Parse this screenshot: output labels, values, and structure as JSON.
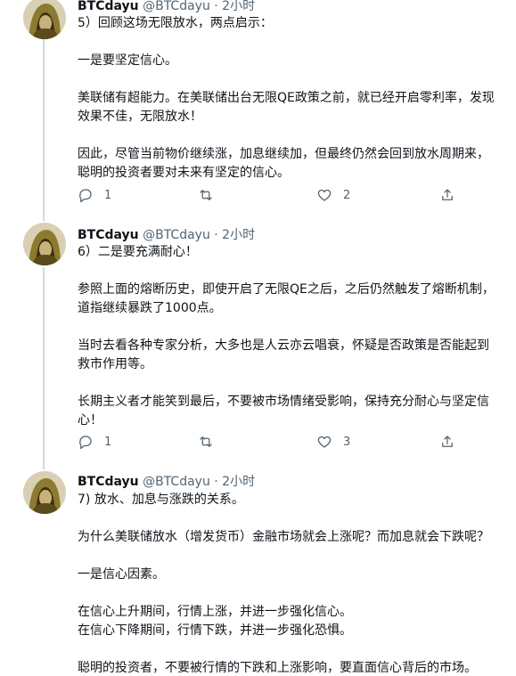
{
  "tweets": [
    {
      "author_name": "BTCdayu",
      "handle_time": "@BTCdayu · 2小时",
      "lines": [
        "5）回顾这场无限放水，两点启示：",
        "",
        "一是要坚定信心。",
        "",
        "美联储有超能力。在美联储出台无限QE政策之前，就已经开启零利率，发现",
        "效果不佳，无限放水！",
        "",
        "因此，尽管当前物价继续涨，加息继续加，但最终仍然会回到放水周期来，",
        "聪明的投资者要对未来有坚定的信心。"
      ],
      "reply_count": "1",
      "retweet_count": "",
      "like_count": "2"
    },
    {
      "author_name": "BTCdayu",
      "handle_time": "@BTCdayu · 2小时",
      "lines": [
        "6）二是要充满耐心！",
        "",
        "参照上面的熔断历史，即使开启了无限QE之后，之后仍然触发了熔断机制，",
        "道指继续暴跌了1000点。",
        "",
        "当时去看各种专家分析，大多也是人云亦云唱衰，怀疑是否政策是否能起到",
        "救市作用等。",
        "",
        "长期主义者才能笑到最后，不要被市场情绪受影响，保持充分耐心与坚定信",
        "心！"
      ],
      "reply_count": "1",
      "retweet_count": "",
      "like_count": "3"
    },
    {
      "author_name": "BTCdayu",
      "handle_time": "@BTCdayu · 2小时",
      "lines": [
        "7) 放水、加息与涨跌的关系。",
        "",
        "为什么美联储放水（增发货币）金融市场就会上涨呢？而加息就会下跌呢？",
        "",
        "一是信心因素。",
        "",
        "在信心上升期间，行情上涨，并进一步强化信心。",
        "在信心下降期间，行情下跌，并进一步强化恐惧。",
        "",
        "聪明的投资者，不要被行情的下跌和上涨影响，要直面信心背后的市场。"
      ],
      "reply_count": "",
      "retweet_count": "",
      "like_count": ""
    }
  ],
  "icons": {
    "reply": "reply-icon",
    "retweet": "retweet-icon",
    "like": "heart-icon",
    "share": "share-icon"
  },
  "colors": {
    "text": "#0f1419",
    "secondary": "#536471",
    "thread_line": "#cfd9de"
  }
}
